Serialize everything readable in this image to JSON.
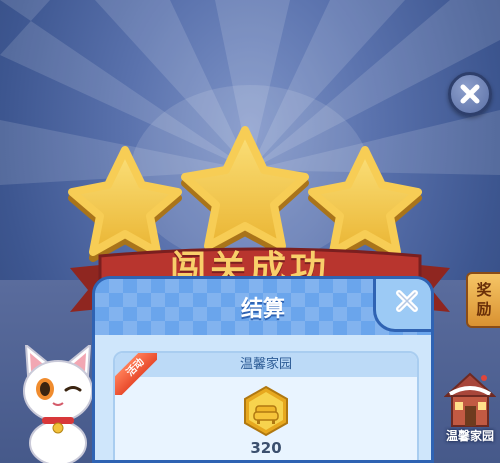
{
  "banner": {
    "title": "闯关成功",
    "stars_earned": 3,
    "stars_total": 3
  },
  "side_tab": {
    "line1": "奖",
    "line2": "励"
  },
  "dialog": {
    "title": "结算",
    "reward": {
      "badge": "活动",
      "category": "温馨家园",
      "amount": "320",
      "icon": "sofa-coin-icon"
    }
  },
  "home_entry": {
    "label": "温馨家园",
    "icon": "house-icon"
  },
  "colors": {
    "dialog_blue": "#4e8fe0",
    "star_gold": "#f5c842",
    "ribbon_red": "#b8352e"
  }
}
